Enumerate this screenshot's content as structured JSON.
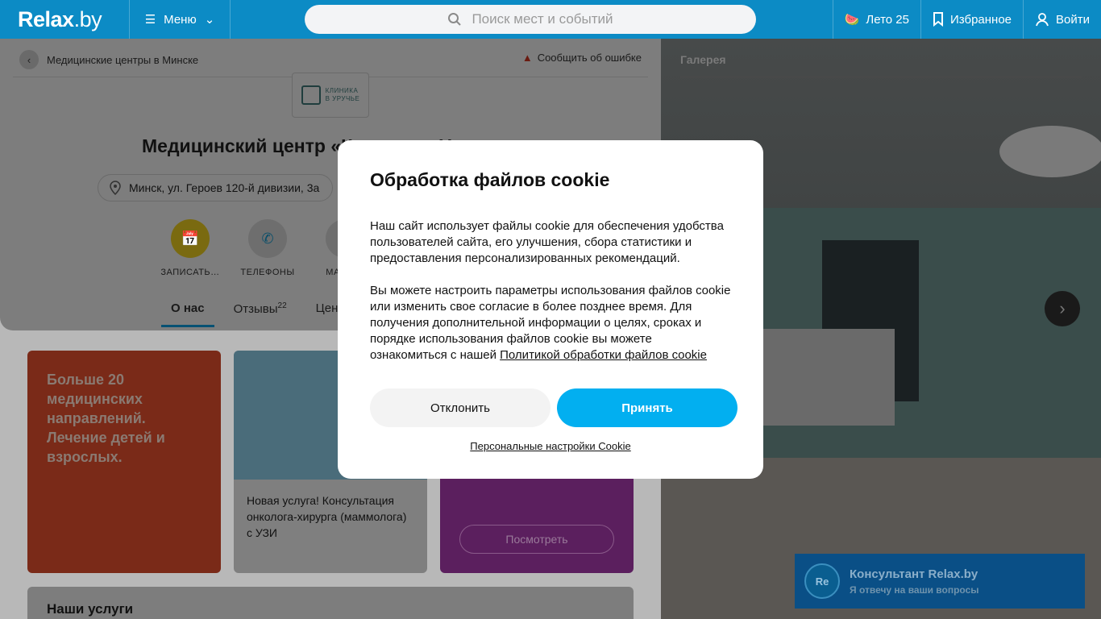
{
  "header": {
    "logo": "Relax",
    "logo_domain": ".by",
    "menu_label": "Меню",
    "search_placeholder": "Поиск мест и событий",
    "summer_label": "Лето 25",
    "favorites_label": "Избранное",
    "login_label": "Войти"
  },
  "breadcrumb": {
    "label": "Медицинские центры в Минске"
  },
  "report_label": "Сообщить об ошибке",
  "clinic_logo_text": [
    "КЛИНИКА",
    "В УРУЧЬЕ"
  ],
  "page_title": "Медицинский центр «Клиника в Уручье»",
  "address": "Минск, ул. Героев 120-й дивизии, 3а",
  "actions": [
    {
      "label": "ЗАПИСАТЬ…",
      "icon": "calendar-icon"
    },
    {
      "label": "ТЕЛЕФОНЫ",
      "icon": "phone-icon"
    },
    {
      "label": "МАРШ…",
      "icon": "route-icon"
    }
  ],
  "tabs": [
    {
      "label": "О нас",
      "active": true
    },
    {
      "label": "Отзывы",
      "badge": "22"
    },
    {
      "label": "Цены"
    }
  ],
  "promos": {
    "red_text": "Больше 20 медицинских направлений. Лечение детей и взрослых.",
    "news_text": "Новая услуга! Консультация онколога-хирурга (маммолога) с УЗИ",
    "purple_button": "Посмотреть"
  },
  "services_title": "Наши услуги",
  "gallery": {
    "label": "Галерея"
  },
  "consultant": {
    "avatar": "Re",
    "title": "Консультант Relax.by",
    "subtitle": "Я отвечу на ваши вопросы"
  },
  "cookie": {
    "title": "Обработка файлов cookie",
    "para1": "Наш сайт использует файлы cookie для обеспечения удобства пользователей сайта, его улучшения, сбора статистики и предоставления персонализированных рекомендаций.",
    "para2": "Вы можете настроить параметры использования файлов cookie или изменить свое согласие в более позднее время. Для получения дополнительной информации о целях, сроках и порядке использования файлов cookie вы можете ознакомиться с нашей ",
    "policy_link": "Политикой обработки файлов cookie",
    "decline": "Отклонить",
    "accept": "Принять",
    "settings": "Персональные настройки Cookie"
  },
  "colors": {
    "header": "#0c8bc5",
    "accept": "#02aff0"
  }
}
